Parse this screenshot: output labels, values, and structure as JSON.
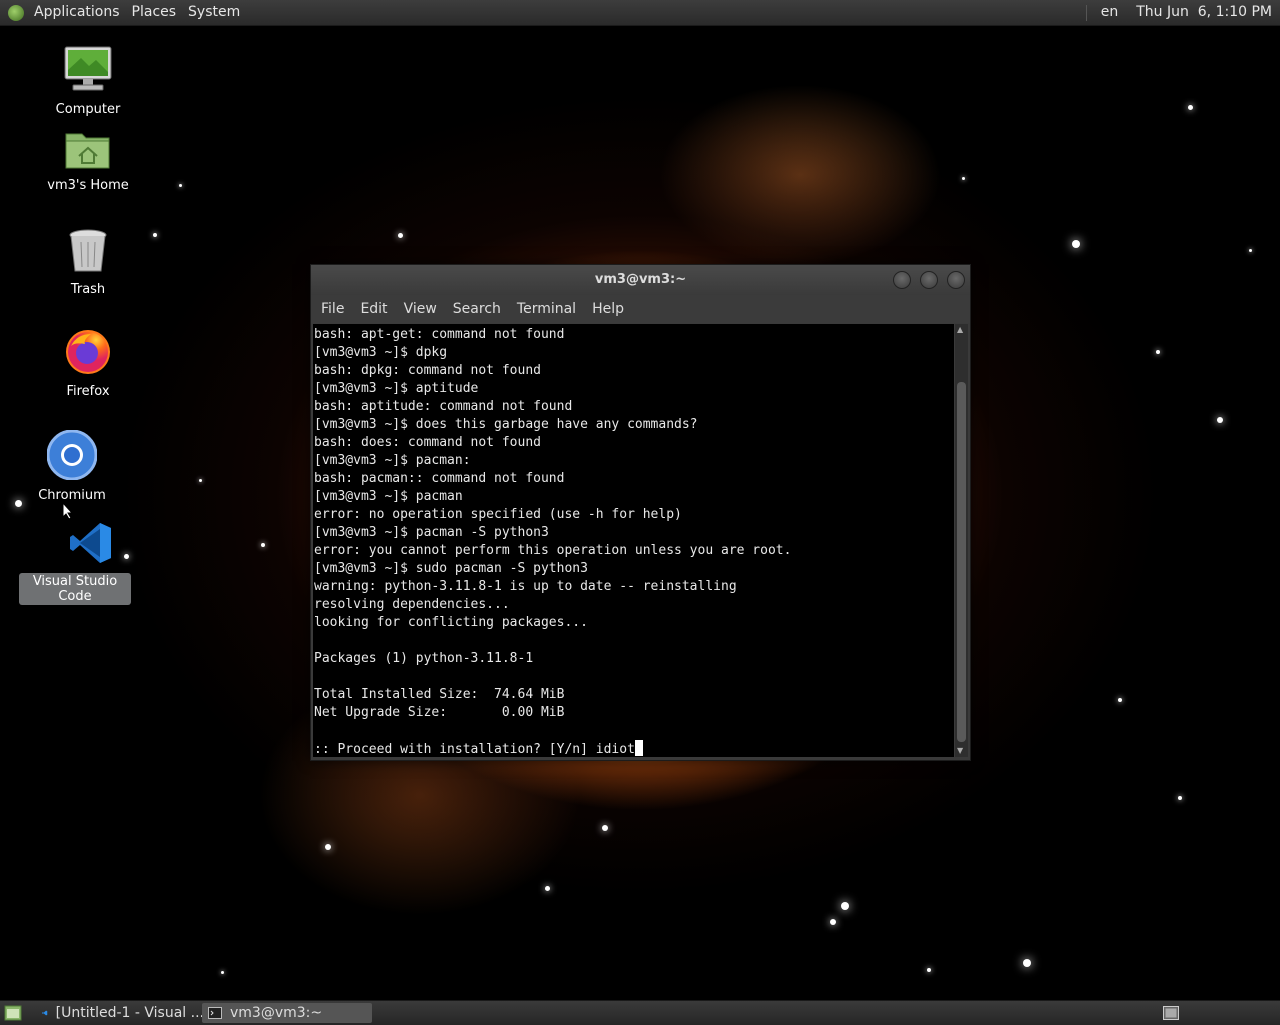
{
  "top_panel": {
    "menus": [
      "Applications",
      "Places",
      "System"
    ],
    "language": "en",
    "clock": "Thu Jun  6, 1:10 PM"
  },
  "desktop_icons": [
    {
      "label": "Computer",
      "icon": "computer-icon"
    },
    {
      "label": "vm3's Home",
      "icon": "home-folder-icon"
    },
    {
      "label": "Trash",
      "icon": "trash-icon"
    },
    {
      "label": "Firefox",
      "icon": "firefox-icon"
    },
    {
      "label": "Chromium",
      "icon": "chromium-icon"
    },
    {
      "label": "Visual Studio Code",
      "icon": "vscode-icon",
      "selected": true
    }
  ],
  "terminal": {
    "title": "vm3@vm3:~",
    "menus": [
      "File",
      "Edit",
      "View",
      "Search",
      "Terminal",
      "Help"
    ],
    "lines": [
      "bash: apt-get: command not found",
      "[vm3@vm3 ~]$ dpkg",
      "bash: dpkg: command not found",
      "[vm3@vm3 ~]$ aptitude",
      "bash: aptitude: command not found",
      "[vm3@vm3 ~]$ does this garbage have any commands?",
      "bash: does: command not found",
      "[vm3@vm3 ~]$ pacman:",
      "bash: pacman:: command not found",
      "[vm3@vm3 ~]$ pacman",
      "error: no operation specified (use -h for help)",
      "[vm3@vm3 ~]$ pacman -S python3",
      "error: you cannot perform this operation unless you are root.",
      "[vm3@vm3 ~]$ sudo pacman -S python3",
      "warning: python-3.11.8-1 is up to date -- reinstalling",
      "resolving dependencies...",
      "looking for conflicting packages...",
      "",
      "Packages (1) python-3.11.8-1",
      "",
      "Total Installed Size:  74.64 MiB",
      "Net Upgrade Size:       0.00 MiB",
      "",
      ":: Proceed with installation? [Y/n] idiot"
    ]
  },
  "taskbar": {
    "tasks": [
      {
        "label": "[Untitled-1 - Visual ...",
        "icon": "vscode-icon",
        "active": false
      },
      {
        "label": "vm3@vm3:~",
        "icon": "terminal-icon",
        "active": true
      }
    ]
  }
}
